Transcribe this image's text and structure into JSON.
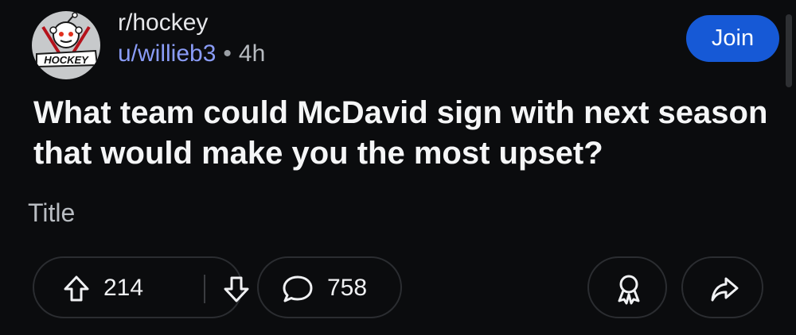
{
  "post": {
    "subreddit": "r/hockey",
    "author": "u/willieb3",
    "separator": "•",
    "age": "4h",
    "title": "What team could McDavid sign with next season that would make you the most upset?",
    "flair": "Title",
    "join_label": "Join",
    "avatar_text": "HOCKEY"
  },
  "actions": {
    "score": "214",
    "comments": "758",
    "icons": [
      "upvote-icon",
      "downvote-icon",
      "comment-icon",
      "award-icon",
      "share-icon"
    ]
  },
  "colors": {
    "background": "#0b0c0e",
    "join_button": "#1659d6",
    "username": "#8a9cf7",
    "pill_border": "#2b2d31"
  }
}
